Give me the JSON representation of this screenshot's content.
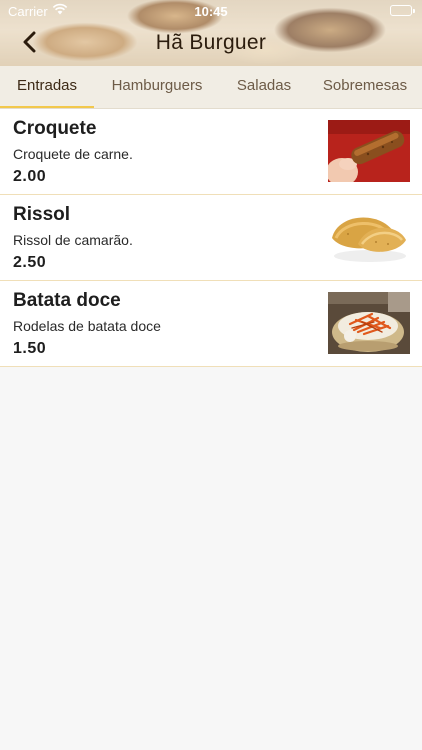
{
  "status_bar": {
    "carrier": "Carrier",
    "time": "10:45"
  },
  "nav": {
    "title": "Hã Burguer",
    "back_icon": "chevron-left-icon"
  },
  "tabs": [
    {
      "label": "Entradas",
      "active": true
    },
    {
      "label": "Hamburguers",
      "active": false
    },
    {
      "label": "Saladas",
      "active": false
    },
    {
      "label": "Sobremesas",
      "active": false
    }
  ],
  "items": [
    {
      "name": "Croquete",
      "description": "Croquete de carne.",
      "price": "2.00"
    },
    {
      "name": "Rissol",
      "description": "Rissol de camarão.",
      "price": "2.50"
    },
    {
      "name": "Batata doce",
      "description": "Rodelas de batata doce",
      "price": "1.50"
    }
  ],
  "colors": {
    "tab_indicator": "#f2c84b",
    "row_divider": "#f0dfb8",
    "tab_bar": "#f1ede4"
  }
}
